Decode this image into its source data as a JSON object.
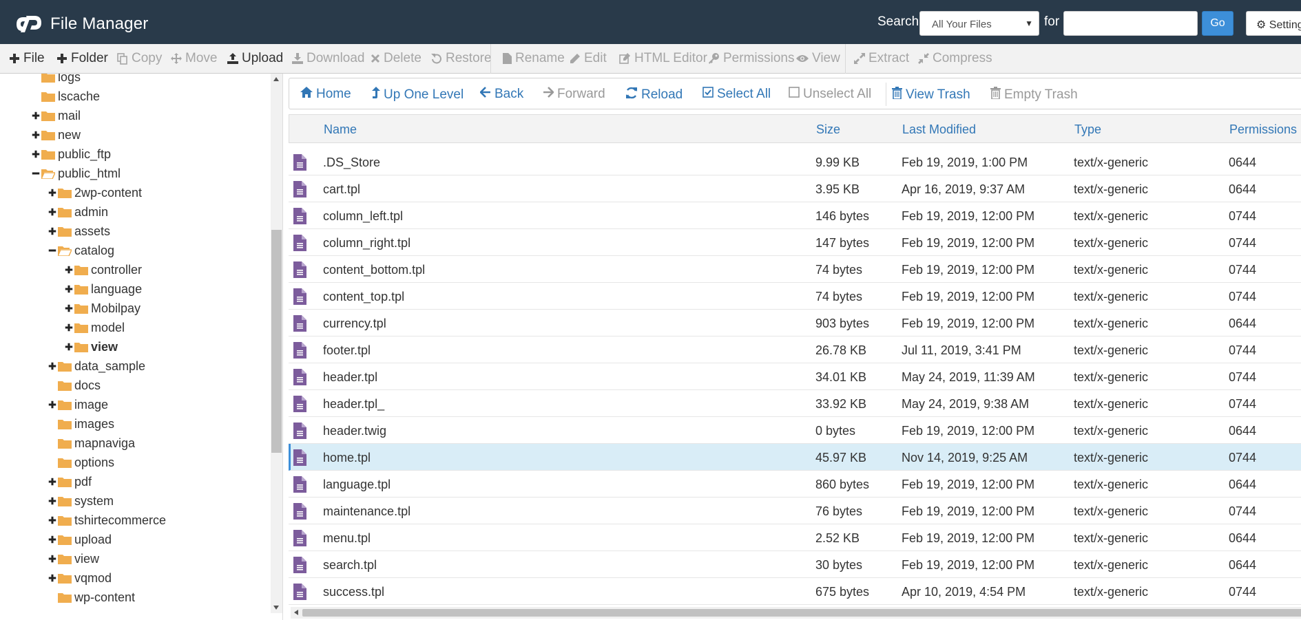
{
  "colors": {
    "header_bg": "#293a4a",
    "accent": "#3d8fd9",
    "link": "#3277b6",
    "folder": "#f0ad4e",
    "file_icon": "#7c5c9c",
    "selected_row": "#d9edf7"
  },
  "header": {
    "app_title": "File Manager",
    "logo_icon": "cpanel-logo-icon",
    "search_label": "Search",
    "scope_value": "All Your Files",
    "for_label": "for",
    "search_value": "",
    "go_label": "Go",
    "settings_label": "Settings"
  },
  "toolbar": [
    {
      "name": "new-file",
      "label": "File",
      "icon": "plus-icon",
      "enabled": true
    },
    {
      "name": "new-folder",
      "label": "Folder",
      "icon": "plus-icon",
      "enabled": true
    },
    {
      "name": "copy",
      "label": "Copy",
      "icon": "copy-icon",
      "enabled": false
    },
    {
      "name": "move",
      "label": "Move",
      "icon": "move-icon",
      "enabled": false
    },
    {
      "name": "upload",
      "label": "Upload",
      "icon": "upload-icon",
      "enabled": true
    },
    {
      "name": "download",
      "label": "Download",
      "icon": "download-icon",
      "enabled": false
    },
    {
      "name": "delete",
      "label": "Delete",
      "icon": "times-icon",
      "enabled": false
    },
    {
      "name": "restore",
      "label": "Restore",
      "icon": "undo-icon",
      "enabled": false
    },
    {
      "name": "rename",
      "label": "Rename",
      "icon": "file-icon",
      "enabled": false
    },
    {
      "name": "edit",
      "label": "Edit",
      "icon": "pencil-icon",
      "enabled": false
    },
    {
      "name": "html-editor",
      "label": "HTML Editor",
      "icon": "edit-square-icon",
      "enabled": false
    },
    {
      "name": "permissions",
      "label": "Permissions",
      "icon": "key-icon",
      "enabled": false
    },
    {
      "name": "view",
      "label": "View",
      "icon": "eye-icon",
      "enabled": false
    },
    {
      "name": "extract",
      "label": "Extract",
      "icon": "expand-icon",
      "enabled": false
    },
    {
      "name": "compress",
      "label": "Compress",
      "icon": "compress-icon",
      "enabled": false
    }
  ],
  "tree": [
    {
      "label": "logs",
      "level": 1,
      "toggle": "none",
      "open": false
    },
    {
      "label": "lscache",
      "level": 1,
      "toggle": "none",
      "open": false
    },
    {
      "label": "mail",
      "level": 1,
      "toggle": "plus",
      "open": false
    },
    {
      "label": "new",
      "level": 1,
      "toggle": "plus",
      "open": false
    },
    {
      "label": "public_ftp",
      "level": 1,
      "toggle": "plus",
      "open": false
    },
    {
      "label": "public_html",
      "level": 1,
      "toggle": "minus",
      "open": true
    },
    {
      "label": "2wp-content",
      "level": 2,
      "toggle": "plus",
      "open": false
    },
    {
      "label": "admin",
      "level": 2,
      "toggle": "plus",
      "open": false
    },
    {
      "label": "assets",
      "level": 2,
      "toggle": "plus",
      "open": false
    },
    {
      "label": "catalog",
      "level": 2,
      "toggle": "minus",
      "open": true
    },
    {
      "label": "controller",
      "level": 3,
      "toggle": "plus",
      "open": false
    },
    {
      "label": "language",
      "level": 3,
      "toggle": "plus",
      "open": false
    },
    {
      "label": "Mobilpay",
      "level": 3,
      "toggle": "plus",
      "open": false
    },
    {
      "label": "model",
      "level": 3,
      "toggle": "plus",
      "open": false
    },
    {
      "label": "view",
      "level": 3,
      "toggle": "plus",
      "open": false,
      "current": true
    },
    {
      "label": "data_sample",
      "level": 2,
      "toggle": "plus",
      "open": false
    },
    {
      "label": "docs",
      "level": 2,
      "toggle": "none",
      "open": false
    },
    {
      "label": "image",
      "level": 2,
      "toggle": "plus",
      "open": false
    },
    {
      "label": "images",
      "level": 2,
      "toggle": "none",
      "open": false
    },
    {
      "label": "mapnaviga",
      "level": 2,
      "toggle": "none",
      "open": false
    },
    {
      "label": "options",
      "level": 2,
      "toggle": "none",
      "open": false
    },
    {
      "label": "pdf",
      "level": 2,
      "toggle": "plus",
      "open": false
    },
    {
      "label": "system",
      "level": 2,
      "toggle": "plus",
      "open": false
    },
    {
      "label": "tshirtecommerce",
      "level": 2,
      "toggle": "plus",
      "open": false
    },
    {
      "label": "upload",
      "level": 2,
      "toggle": "plus",
      "open": false
    },
    {
      "label": "view",
      "level": 2,
      "toggle": "plus",
      "open": false
    },
    {
      "label": "vqmod",
      "level": 2,
      "toggle": "plus",
      "open": false
    },
    {
      "label": "wp-content",
      "level": 2,
      "toggle": "none",
      "open": false
    }
  ],
  "navbar": [
    {
      "name": "home",
      "label": "Home",
      "icon": "home-icon",
      "enabled": true
    },
    {
      "name": "up-one-level",
      "label": "Up One Level",
      "icon": "level-up-icon",
      "enabled": true
    },
    {
      "name": "back",
      "label": "Back",
      "icon": "arrow-left-icon",
      "enabled": true
    },
    {
      "name": "forward",
      "label": "Forward",
      "icon": "arrow-right-icon",
      "enabled": false
    },
    {
      "name": "reload",
      "label": "Reload",
      "icon": "refresh-icon",
      "enabled": true
    },
    {
      "name": "select-all",
      "label": "Select All",
      "icon": "checkbox-checked-icon",
      "enabled": true
    },
    {
      "name": "unselect-all",
      "label": "Unselect All",
      "icon": "checkbox-empty-icon",
      "enabled": false
    },
    {
      "name": "view-trash",
      "label": "View Trash",
      "icon": "trash-icon",
      "enabled": true
    },
    {
      "name": "empty-trash",
      "label": "Empty Trash",
      "icon": "trash-icon",
      "enabled": false
    }
  ],
  "table": {
    "columns": [
      "Name",
      "Size",
      "Last Modified",
      "Type",
      "Permissions"
    ],
    "rows": [
      {
        "name": ".DS_Store",
        "size": "9.99 KB",
        "modified": "Feb 19, 2019, 1:00 PM",
        "type": "text/x-generic",
        "perms": "0644"
      },
      {
        "name": "cart.tpl",
        "size": "3.95 KB",
        "modified": "Apr 16, 2019, 9:37 AM",
        "type": "text/x-generic",
        "perms": "0644"
      },
      {
        "name": "column_left.tpl",
        "size": "146 bytes",
        "modified": "Feb 19, 2019, 12:00 PM",
        "type": "text/x-generic",
        "perms": "0744"
      },
      {
        "name": "column_right.tpl",
        "size": "147 bytes",
        "modified": "Feb 19, 2019, 12:00 PM",
        "type": "text/x-generic",
        "perms": "0744"
      },
      {
        "name": "content_bottom.tpl",
        "size": "74 bytes",
        "modified": "Feb 19, 2019, 12:00 PM",
        "type": "text/x-generic",
        "perms": "0744"
      },
      {
        "name": "content_top.tpl",
        "size": "74 bytes",
        "modified": "Feb 19, 2019, 12:00 PM",
        "type": "text/x-generic",
        "perms": "0744"
      },
      {
        "name": "currency.tpl",
        "size": "903 bytes",
        "modified": "Feb 19, 2019, 12:00 PM",
        "type": "text/x-generic",
        "perms": "0644"
      },
      {
        "name": "footer.tpl",
        "size": "26.78 KB",
        "modified": "Jul 11, 2019, 3:41 PM",
        "type": "text/x-generic",
        "perms": "0744"
      },
      {
        "name": "header.tpl",
        "size": "34.01 KB",
        "modified": "May 24, 2019, 11:39 AM",
        "type": "text/x-generic",
        "perms": "0744"
      },
      {
        "name": "header.tpl_",
        "size": "33.92 KB",
        "modified": "May 24, 2019, 9:38 AM",
        "type": "text/x-generic",
        "perms": "0744"
      },
      {
        "name": "header.twig",
        "size": "0 bytes",
        "modified": "Feb 19, 2019, 12:00 PM",
        "type": "text/x-generic",
        "perms": "0644"
      },
      {
        "name": "home.tpl",
        "size": "45.97 KB",
        "modified": "Nov 14, 2019, 9:25 AM",
        "type": "text/x-generic",
        "perms": "0744",
        "selected": true
      },
      {
        "name": "language.tpl",
        "size": "860 bytes",
        "modified": "Feb 19, 2019, 12:00 PM",
        "type": "text/x-generic",
        "perms": "0644"
      },
      {
        "name": "maintenance.tpl",
        "size": "76 bytes",
        "modified": "Feb 19, 2019, 12:00 PM",
        "type": "text/x-generic",
        "perms": "0744"
      },
      {
        "name": "menu.tpl",
        "size": "2.52 KB",
        "modified": "Feb 19, 2019, 12:00 PM",
        "type": "text/x-generic",
        "perms": "0644"
      },
      {
        "name": "search.tpl",
        "size": "30 bytes",
        "modified": "Feb 19, 2019, 12:00 PM",
        "type": "text/x-generic",
        "perms": "0644"
      },
      {
        "name": "success.tpl",
        "size": "675 bytes",
        "modified": "Apr 10, 2019, 4:54 PM",
        "type": "text/x-generic",
        "perms": "0744"
      }
    ]
  }
}
